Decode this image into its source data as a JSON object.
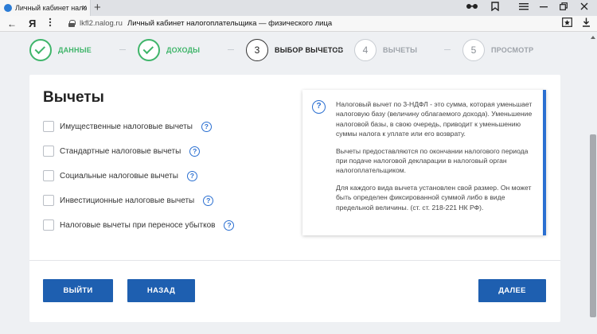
{
  "browser": {
    "tab_title": "Личный кабинет налогоплательщика",
    "tab_close": "×",
    "new_tab": "+",
    "toolbar_icons": [
      "glasses-icon",
      "bookmark-icon",
      "menu-icon",
      "minimize-icon",
      "restore-icon",
      "close-icon"
    ],
    "address": {
      "back": "←",
      "browser_logo": "Я",
      "domain": "lkfl2.nalog.ru",
      "page_title": "Личный кабинет налогоплательщика — физического лица",
      "actions": [
        "bookmark-star-icon",
        "download-icon"
      ]
    }
  },
  "stepper": {
    "steps": [
      {
        "number": "",
        "label": "ДАННЫЕ",
        "state": "done"
      },
      {
        "number": "",
        "label": "ДОХОДЫ",
        "state": "done"
      },
      {
        "number": "3",
        "label": "ВЫБОР ВЫЧЕТОВ",
        "state": "current"
      },
      {
        "number": "4",
        "label": "ВЫЧЕТЫ",
        "state": "todo"
      },
      {
        "number": "5",
        "label": "ПРОСМОТР",
        "state": "todo"
      }
    ]
  },
  "main": {
    "heading": "Вычеты",
    "options": [
      {
        "label": "Имущественные налоговые вычеты",
        "checked": false
      },
      {
        "label": "Стандартные налоговые вычеты",
        "checked": false
      },
      {
        "label": "Социальные налоговые вычеты",
        "checked": false
      },
      {
        "label": "Инвестиционные налоговые вычеты",
        "checked": false
      },
      {
        "label": "Налоговые вычеты при переносе убытков",
        "checked": false
      }
    ],
    "help_glyph": "?",
    "info": {
      "icon_glyph": "?",
      "paragraphs": [
        "Налоговый вычет по 3-НДФЛ - это сумма, которая уменьшает налоговую базу (величину облагаемого дохода). Уменьшение налоговой базы, в свою очередь, приводит к уменьшению суммы налога к уплате или его возврату.",
        "Вычеты предоставляются по окончании налогового периода при подаче налоговой декларации в налоговый орган налогоплательщиком.",
        "Для каждого вида вычета установлен свой размер. Он может быть определен фиксированной суммой либо в виде предельной величины. (ст. ст. 218-221 НК РФ)."
      ]
    },
    "buttons": {
      "exit": "ВЫЙТИ",
      "back": "НАЗАД",
      "next": "ДАЛЕЕ"
    }
  },
  "colors": {
    "accent": "#1e5fb0",
    "done_green": "#3fb56a",
    "info_border": "#2a6fd1"
  }
}
